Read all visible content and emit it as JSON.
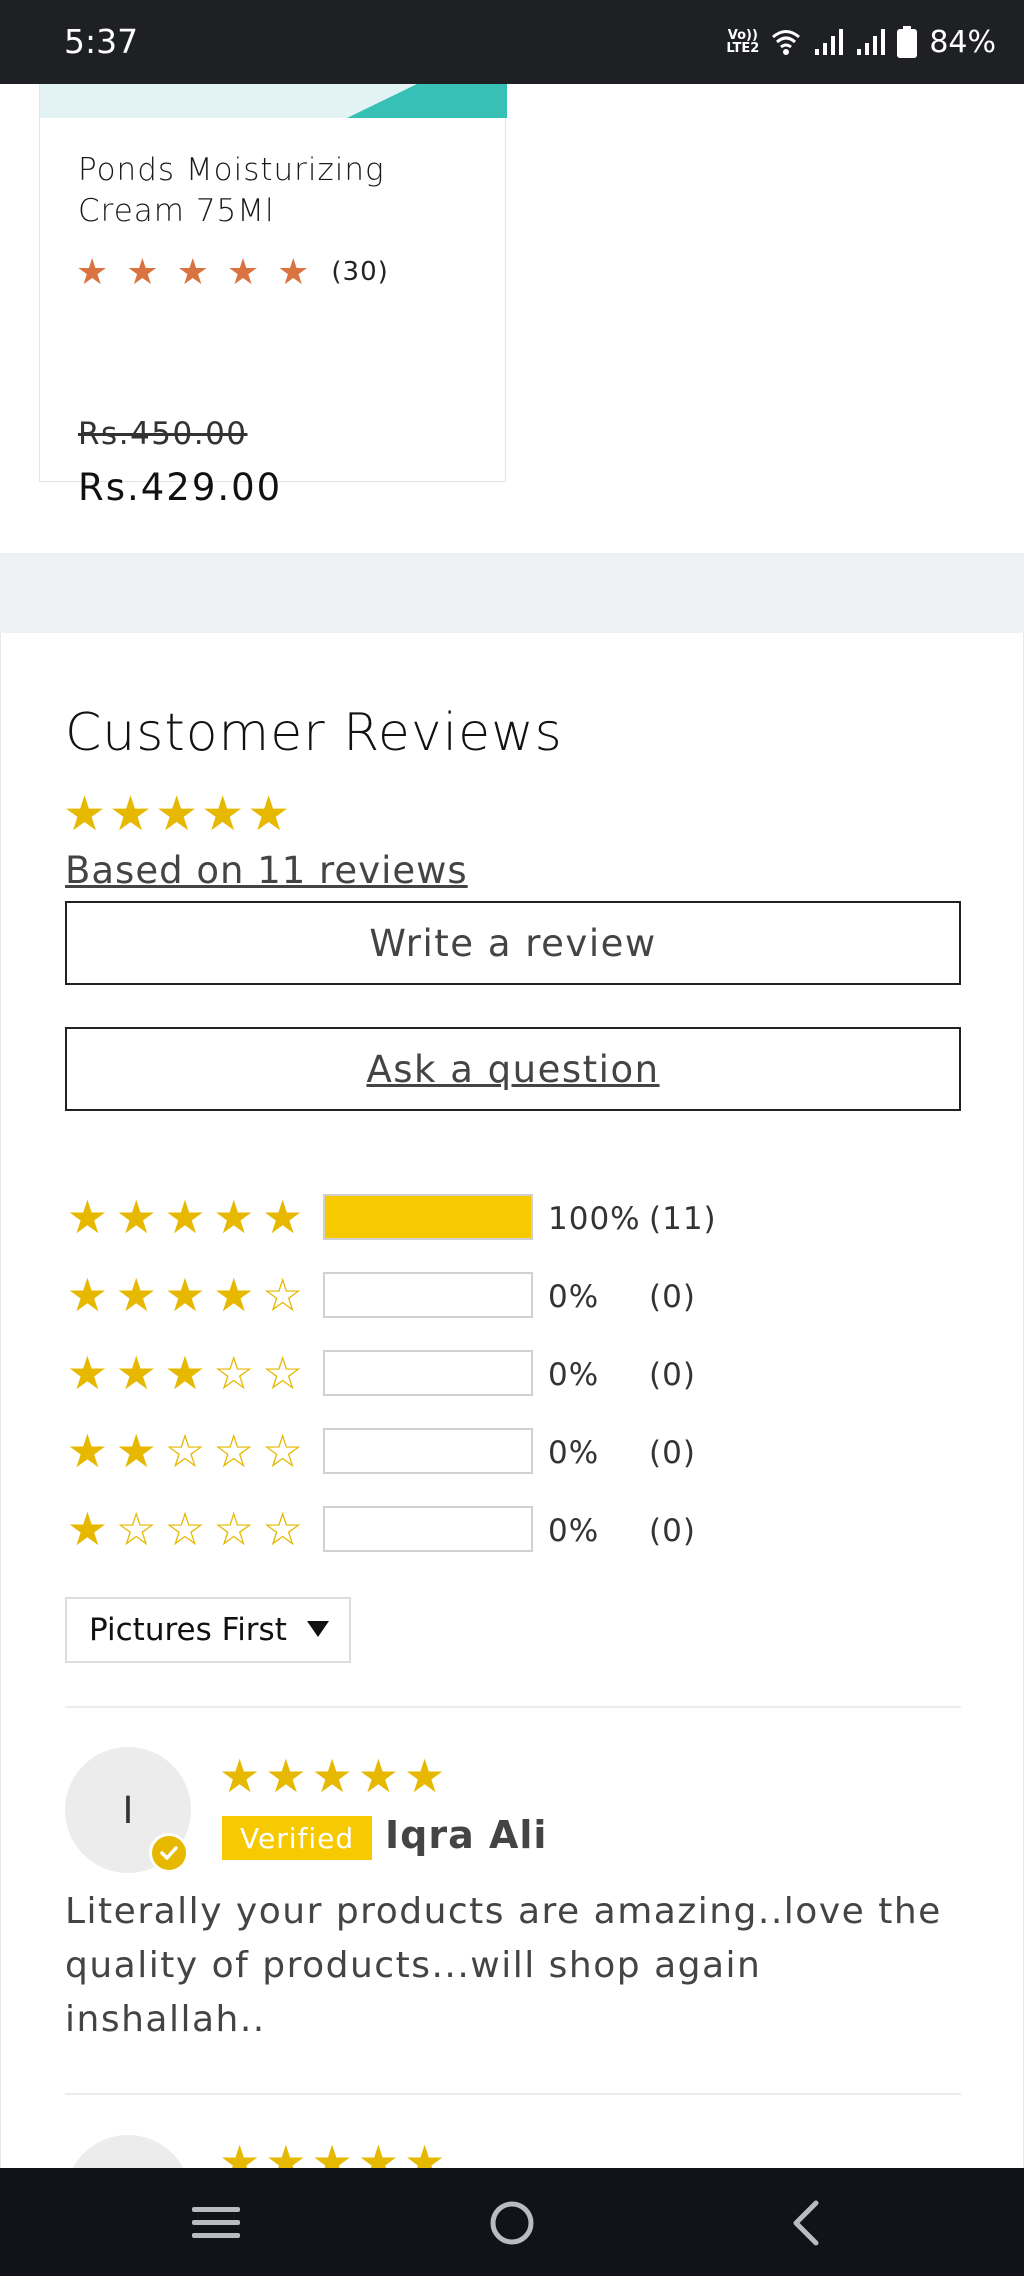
{
  "status_bar": {
    "time": "5:37",
    "network_badge_top": "Vo))",
    "network_badge_bottom": "LTE2",
    "battery": "84%",
    "icons": [
      "wifi-icon",
      "signal-icon",
      "signal-icon",
      "battery-icon"
    ]
  },
  "product": {
    "name": "Ponds Moisturizing Cream 75Ml",
    "rating_stars": 5,
    "rating_count": "(30)",
    "old_price": "Rs.450.00",
    "new_price": "Rs.429.00",
    "accent_color": "#37c0b5"
  },
  "reviews": {
    "title": "Customer Reviews",
    "average_stars": 5,
    "based_on": "Based on 11 reviews",
    "write_button": "Write a review",
    "ask_button": "Ask a question",
    "histogram": [
      {
        "stars": 5,
        "fraction": 1.0,
        "percent": "100%",
        "count": "(11)"
      },
      {
        "stars": 4,
        "fraction": 0.0,
        "percent": "0%",
        "count": "(0)"
      },
      {
        "stars": 3,
        "fraction": 0.0,
        "percent": "0%",
        "count": "(0)"
      },
      {
        "stars": 2,
        "fraction": 0.0,
        "percent": "0%",
        "count": "(0)"
      },
      {
        "stars": 1,
        "fraction": 0.0,
        "percent": "0%",
        "count": "(0)"
      }
    ],
    "sort": {
      "selected": "Pictures First"
    },
    "items": [
      {
        "avatar_initial": "I",
        "stars": 5,
        "verified_label": "Verified",
        "name": "Iqra Ali",
        "body": "Literally your products are amazing..love the quality of products...will shop again inshallah.."
      }
    ],
    "star_color": "#e6b800",
    "bar_color": "#f7c900"
  },
  "nav": {
    "buttons": [
      "menu-icon",
      "home-icon",
      "back-icon"
    ]
  }
}
